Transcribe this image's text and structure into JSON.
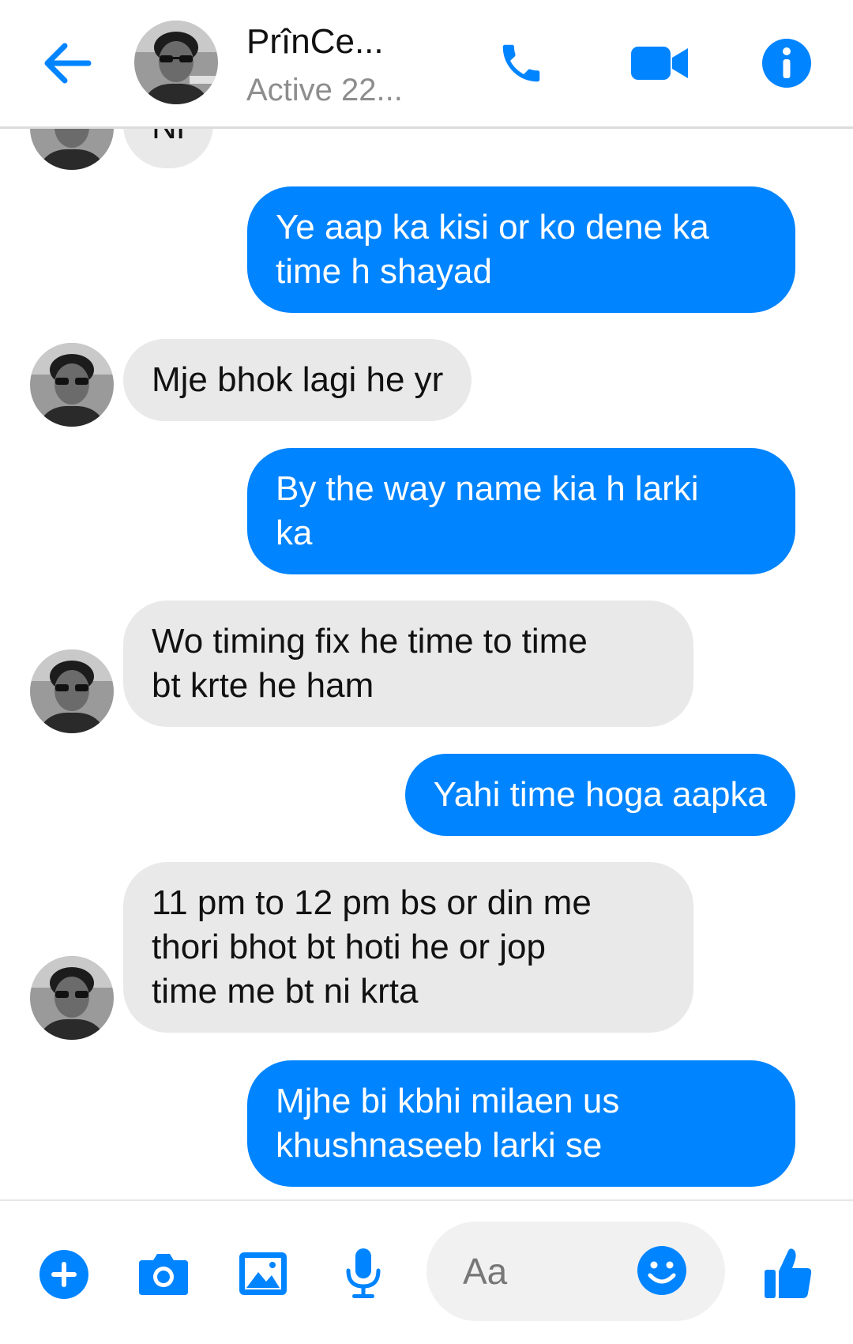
{
  "header": {
    "contact_name": "PrînCe...",
    "status": "Active 22...",
    "icons": {
      "back": "back-arrow-icon",
      "call": "phone-icon",
      "video": "video-camera-icon",
      "info": "info-icon"
    }
  },
  "messages": [
    {
      "direction": "in",
      "text": "Ni"
    },
    {
      "direction": "out",
      "text": "Ye aap ka kisi or ko dene ka\ntime h shayad"
    },
    {
      "direction": "in",
      "text": "Mje bhok lagi he yr"
    },
    {
      "direction": "out",
      "text": "By the way name kia h larki\nka"
    },
    {
      "direction": "in",
      "text": "Wo timing fix he time to time\nbt krte he ham"
    },
    {
      "direction": "out",
      "text": "Yahi time hoga aapka"
    },
    {
      "direction": "in",
      "text": "11 pm to 12 pm bs or din me\nthori bhot bt hoti he or  jop\ntime me bt ni krta"
    },
    {
      "direction": "out",
      "text": "Mjhe bi kbhi milaen us\nkhushnaseeb larki se"
    }
  ],
  "composer": {
    "placeholder": "Aa",
    "icons": [
      "plus-icon",
      "camera-icon",
      "gallery-icon",
      "microphone-icon",
      "emoji-icon",
      "thumbs-up-icon"
    ]
  },
  "colors": {
    "accent": "#0084ff",
    "incoming_bubble": "#e9e9e9",
    "outgoing_text": "#ffffff"
  }
}
